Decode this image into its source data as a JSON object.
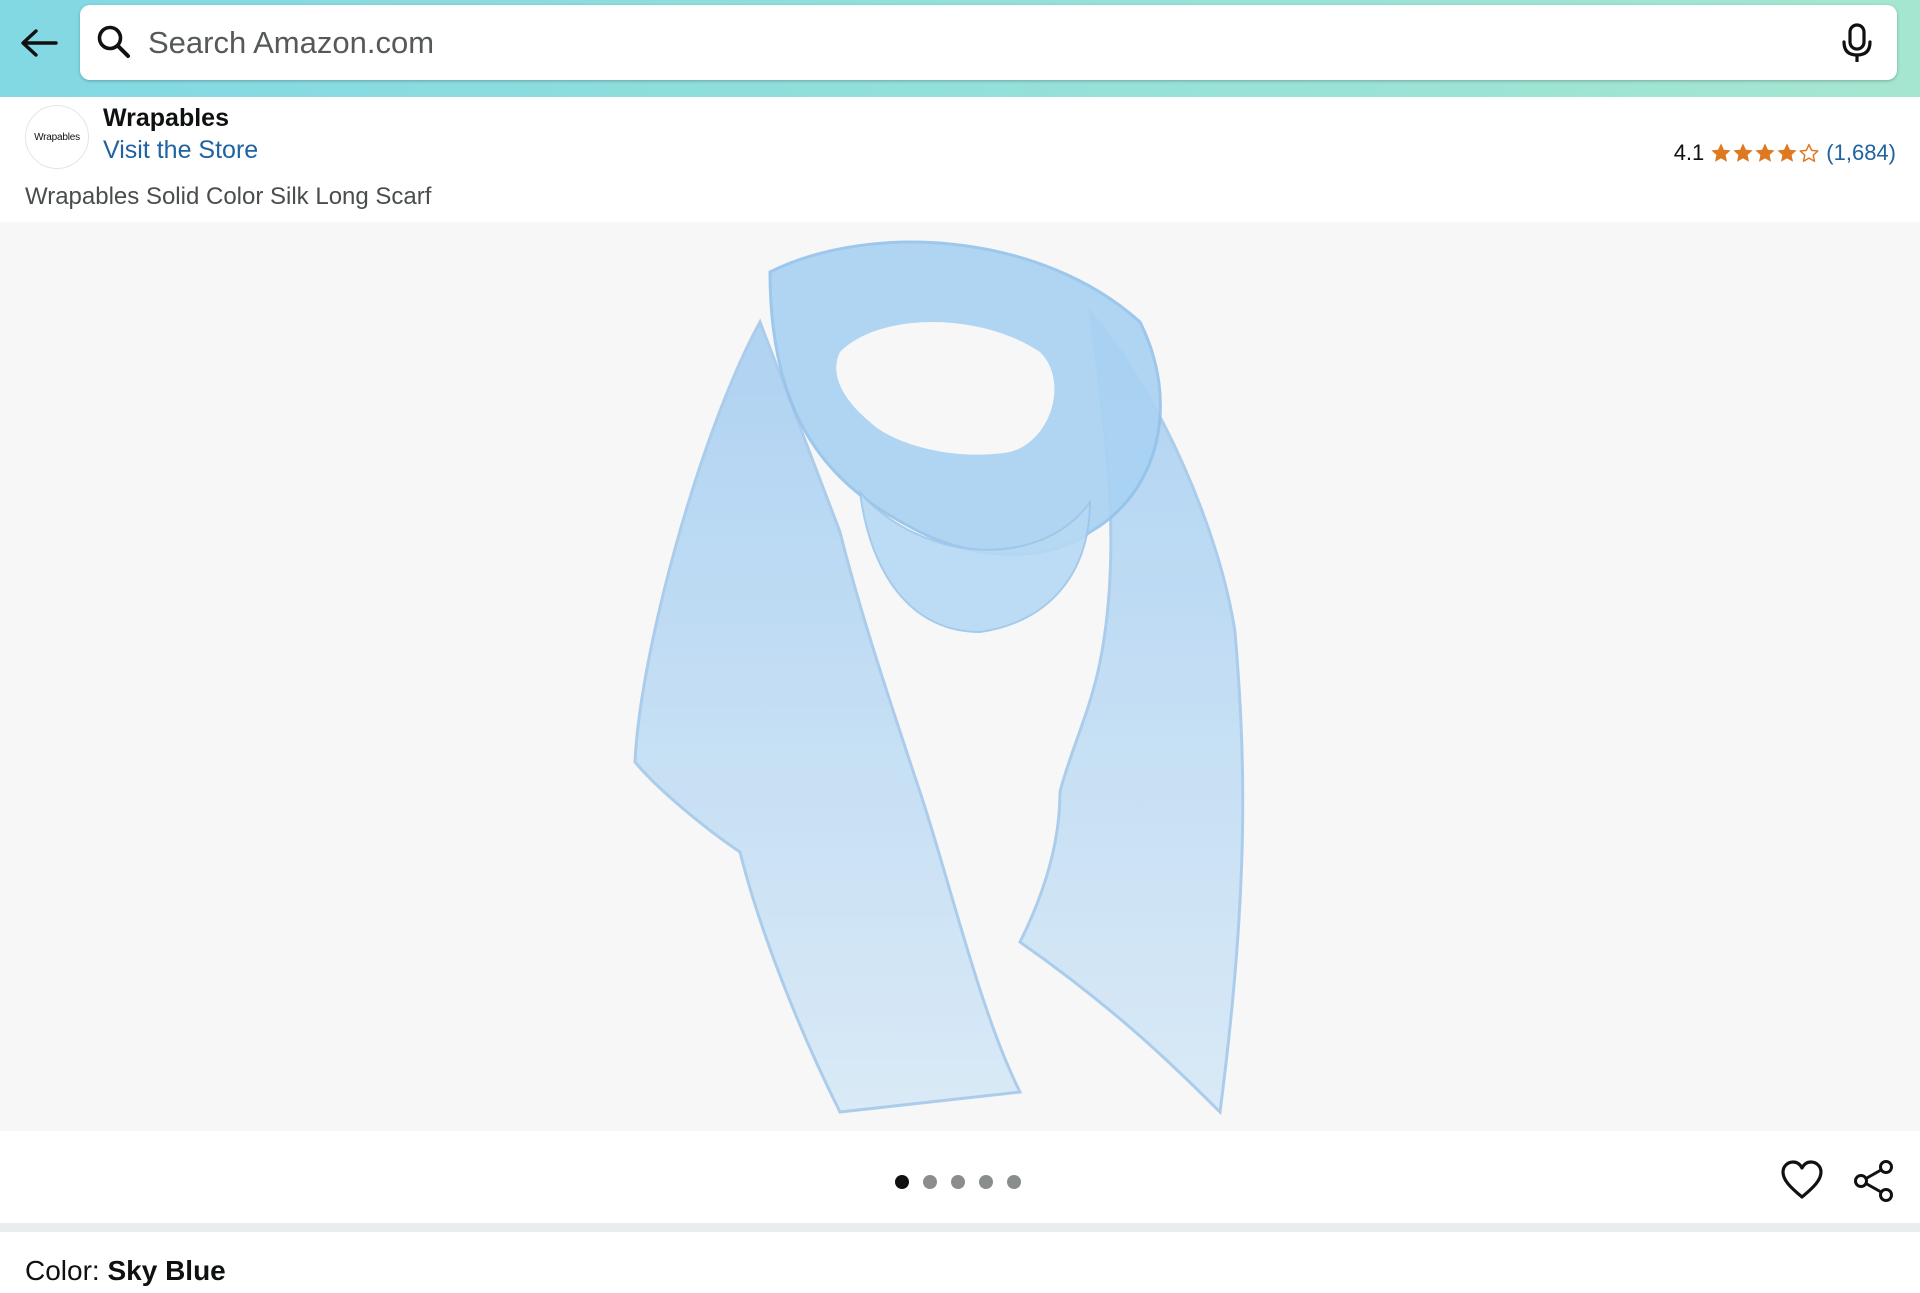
{
  "header": {
    "back_icon": "arrow-left-icon",
    "search": {
      "placeholder": "Search Amazon.com",
      "value": "",
      "search_icon": "magnifier-icon",
      "mic_icon": "microphone-icon"
    },
    "gradient_colors": [
      "#82d8e3",
      "#a5e6d0"
    ]
  },
  "brand": {
    "logo_text": "Wrapables",
    "name": "Wrapables",
    "store_link": "Visit the Store"
  },
  "rating": {
    "value": "4.1",
    "stars": 4.1,
    "count": "(1,684)",
    "star_color": "#de7921"
  },
  "product": {
    "title": "Wrapables Solid Color Silk Long Scarf",
    "image_description_icon": "scarf-image"
  },
  "gallery": {
    "image_count": 5,
    "active_index": 0,
    "heart_icon": "heart-icon",
    "share_icon": "share-icon"
  },
  "variant": {
    "label": "Color:",
    "value": "Sky Blue"
  },
  "colors": {
    "link": "#2162a1",
    "text": "#0f1111",
    "muted": "#494d4d",
    "scarf": "#a9d2f3"
  }
}
